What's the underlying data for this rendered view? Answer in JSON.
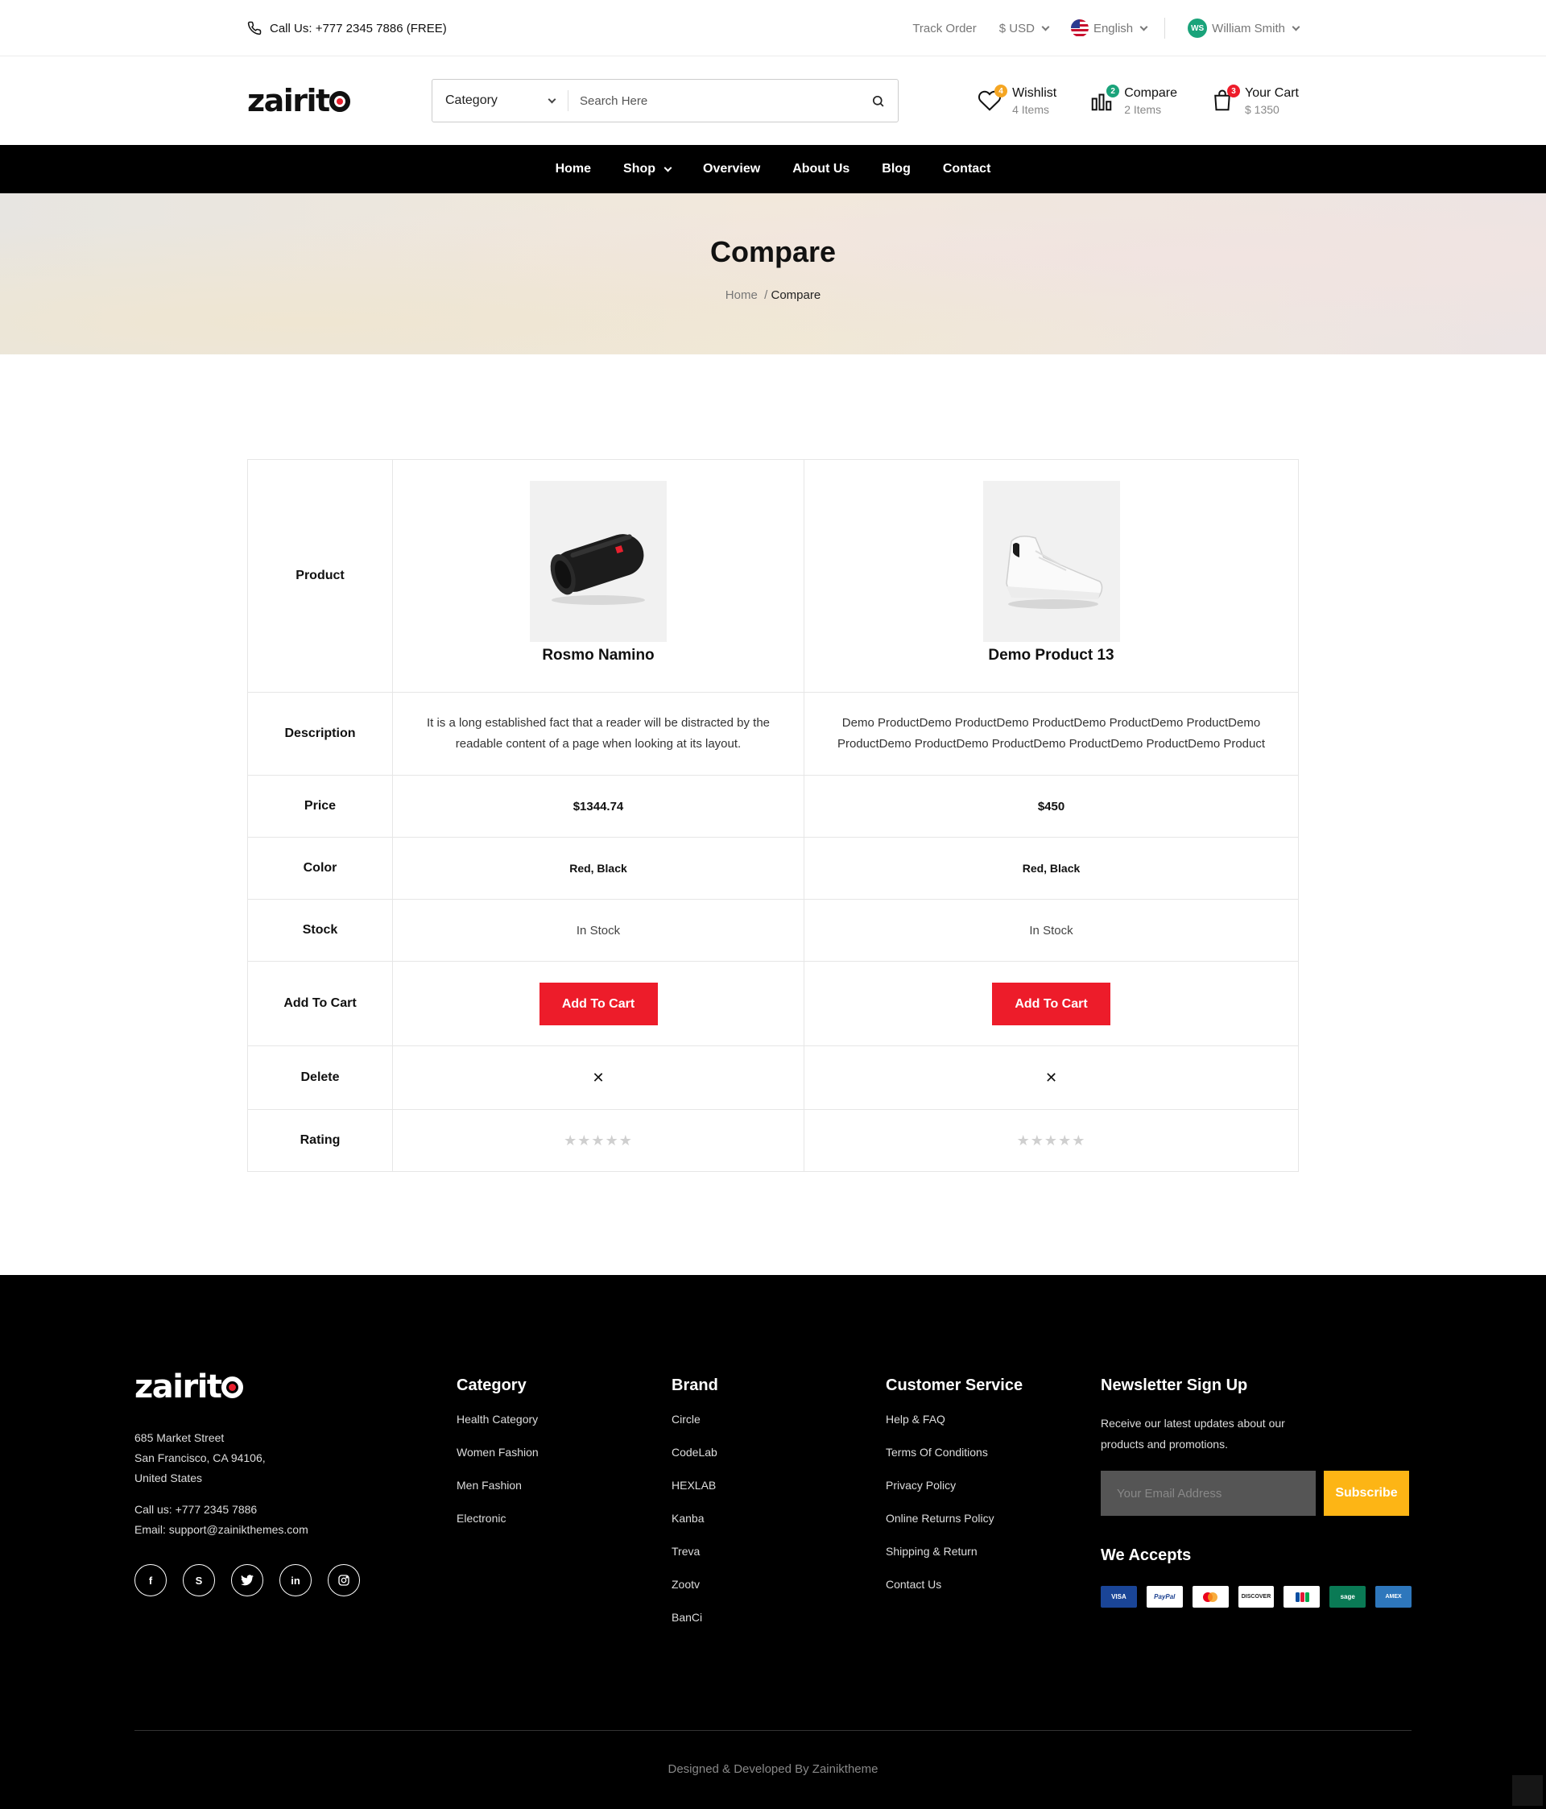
{
  "topbar": {
    "call_label": "Call Us:",
    "call_number": "+777 2345 7886 (FREE)",
    "track_order": "Track Order",
    "currency": "$ USD",
    "language": "English",
    "user_initials": "WS",
    "user_name": "William Smith"
  },
  "header": {
    "logo_pre": "zairit",
    "search_category": "Category",
    "search_placeholder": "Search Here",
    "wishlist": {
      "label": "Wishlist",
      "sub": "4 Items",
      "count": "4"
    },
    "compare": {
      "label": "Compare",
      "sub": "2 Items",
      "count": "2"
    },
    "cart": {
      "label": "Your Cart",
      "sub": "$ 1350",
      "count": "3"
    }
  },
  "nav": [
    "Home",
    "Shop",
    "Overview",
    "About Us",
    "Blog",
    "Contact"
  ],
  "hero": {
    "title": "Compare",
    "crumb_home": "Home",
    "crumb_sep": "/",
    "crumb_current": "Compare"
  },
  "compare": {
    "labels": {
      "product": "Product",
      "description": "Description",
      "price": "Price",
      "color": "Color",
      "stock": "Stock",
      "add_to_cart": "Add To Cart",
      "delete": "Delete",
      "rating": "Rating"
    },
    "products": [
      {
        "name": "Rosmo Namino",
        "image": "speaker-image",
        "description": "It is a long established fact that a reader will be distracted by the readable content of a page when looking at its layout.",
        "price": "$1344.74",
        "color": "Red, Black",
        "stock": "In Stock",
        "button": "Add To Cart",
        "delete": "✕",
        "rating": "★★★★★"
      },
      {
        "name": "Demo Product 13",
        "image": "sneaker-image",
        "description": "Demo ProductDemo ProductDemo ProductDemo ProductDemo ProductDemo ProductDemo ProductDemo ProductDemo ProductDemo ProductDemo Product",
        "price": "$450",
        "color": "Red, Black",
        "stock": "In Stock",
        "button": "Add To Cart",
        "delete": "✕",
        "rating": "★★★★★"
      }
    ]
  },
  "footer": {
    "logo_pre": "zairit",
    "address": [
      "685 Market Street",
      "San Francisco, CA 94106,",
      "United States"
    ],
    "call": "Call us: +777 2345 7886",
    "email": "Email: support@zainikthemes.com",
    "socials": [
      "facebook-icon",
      "skype-icon",
      "twitter-icon",
      "linkedin-icon",
      "instagram-icon"
    ],
    "category": {
      "title": "Category",
      "items": [
        "Health Category",
        "Women Fashion",
        "Men Fashion",
        "Electronic"
      ]
    },
    "brand": {
      "title": "Brand",
      "items": [
        "Circle",
        "CodeLab",
        "HEXLAB",
        "Kanba",
        "Treva",
        "Zootv",
        "BanCi"
      ]
    },
    "service": {
      "title": "Customer Service",
      "items": [
        "Help & FAQ",
        "Terms Of Conditions",
        "Privacy Policy",
        "Online Returns Policy",
        "Shipping & Return",
        "Contact Us"
      ]
    },
    "newsletter": {
      "title": "Newsletter Sign Up",
      "text": "Receive our latest updates about our products and promotions.",
      "placeholder": "Your Email Address",
      "button": "Subscribe",
      "accepts_title": "We Accepts",
      "payments": [
        "VISA",
        "PayPal",
        "mastercard",
        "DISCOVER",
        "JCB",
        "sage",
        "AMEX"
      ]
    },
    "copyright": "Designed & Developed By Zainiktheme"
  },
  "colors": {
    "accent_red": "#ed1c2a",
    "subscribe_yellow": "#fdb515",
    "nav_bg": "#000000"
  }
}
